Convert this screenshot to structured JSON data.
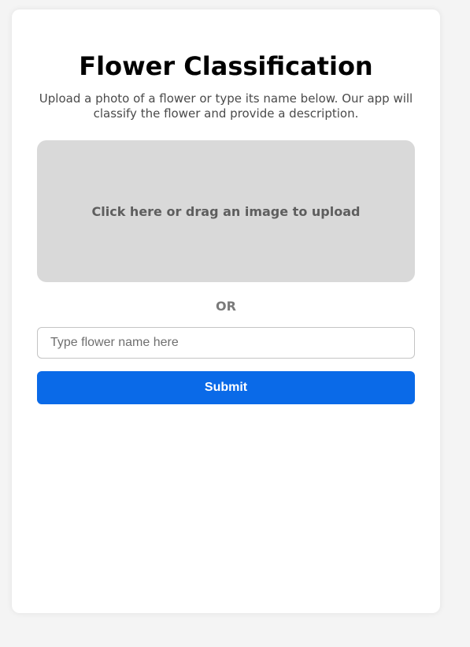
{
  "page": {
    "title": "Flower Classification",
    "description": "Upload a photo of a flower or type its name below. Our app will classify the flower and provide a description."
  },
  "upload": {
    "label": "Click here or drag an image to upload"
  },
  "separator": {
    "label": "OR"
  },
  "name_input": {
    "placeholder": "Type flower name here",
    "value": ""
  },
  "submit": {
    "label": "Submit"
  },
  "colors": {
    "background": "#f4f4f4",
    "card": "#ffffff",
    "dropzone": "#d9d9d9",
    "accent": "#0a6ae8"
  }
}
